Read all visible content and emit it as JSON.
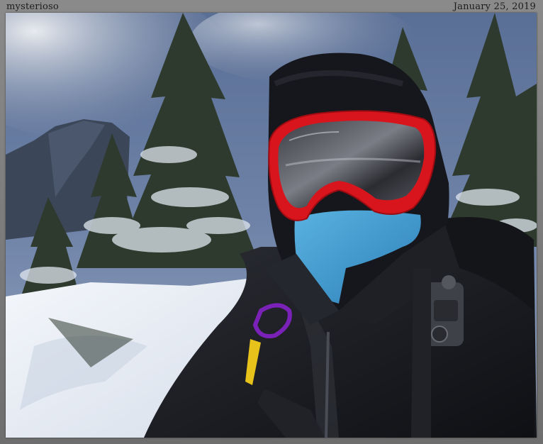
{
  "caption": {
    "author": "mysterioso",
    "date": "January 25, 2019"
  },
  "photo": {
    "subject": "hiker-selfie-in-snowy-forest",
    "colors": {
      "sky": "#4f6a9c",
      "cloud": "#d9dde4",
      "snow": "#eef2f7",
      "jacket": "#1a1b1f",
      "goggle_frame": "#d8141d",
      "buff": "#3a9ad0",
      "carabiner": "#7a22b8",
      "clip": "#e6c21a"
    }
  }
}
